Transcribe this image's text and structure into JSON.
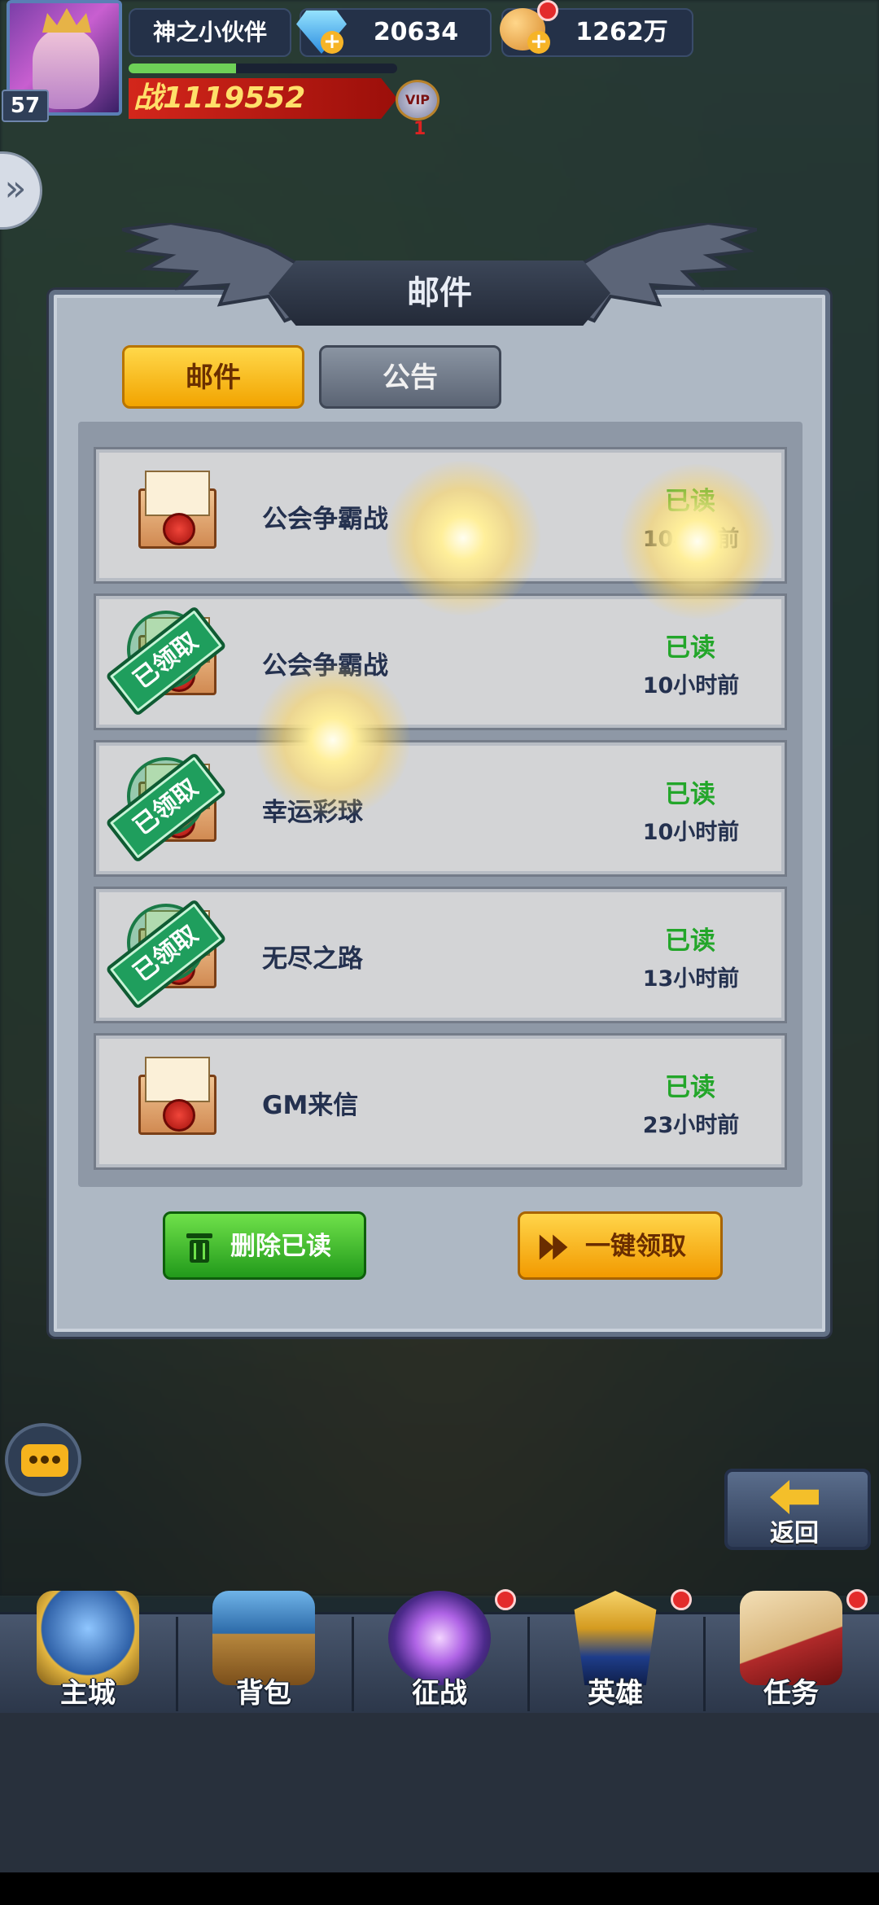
{
  "player": {
    "name": "神之小伙伴",
    "level": "57",
    "power_prefix": "战",
    "power": "1119552",
    "vip_label": "VIP",
    "vip_level": "1",
    "exp_percent": 40
  },
  "resources": {
    "diamonds": "20634",
    "gold": "1262万"
  },
  "dialog": {
    "title": "邮件",
    "tabs": [
      {
        "label": "邮件",
        "active": true
      },
      {
        "label": "公告",
        "active": false
      }
    ],
    "claimed_stamp": "已领取",
    "mails": [
      {
        "title": "公会争霸战",
        "status": "已读",
        "time": "10小时前",
        "claimed": false
      },
      {
        "title": "公会争霸战",
        "status": "已读",
        "time": "10小时前",
        "claimed": true
      },
      {
        "title": "幸运彩球",
        "status": "已读",
        "time": "10小时前",
        "claimed": true
      },
      {
        "title": "无尽之路",
        "status": "已读",
        "time": "13小时前",
        "claimed": true
      },
      {
        "title": "GM来信",
        "status": "已读",
        "time": "23小时前",
        "claimed": false
      }
    ],
    "delete_read_label": "删除已读",
    "claim_all_label": "一键领取"
  },
  "back_label": "返回",
  "nav": [
    {
      "label": "主城",
      "icon": "castle-icon",
      "badge": false
    },
    {
      "label": "背包",
      "icon": "treasure-chest-icon",
      "badge": false
    },
    {
      "label": "征战",
      "icon": "dragon-portal-icon",
      "badge": true
    },
    {
      "label": "英雄",
      "icon": "hero-helmet-icon",
      "badge": true
    },
    {
      "label": "任务",
      "icon": "quest-scroll-icon",
      "badge": true
    }
  ],
  "colors": {
    "read_status": "#23a62a",
    "primary_button": "#f2a400",
    "delete_button": "#229a1b",
    "badge": "#e32b2b"
  }
}
